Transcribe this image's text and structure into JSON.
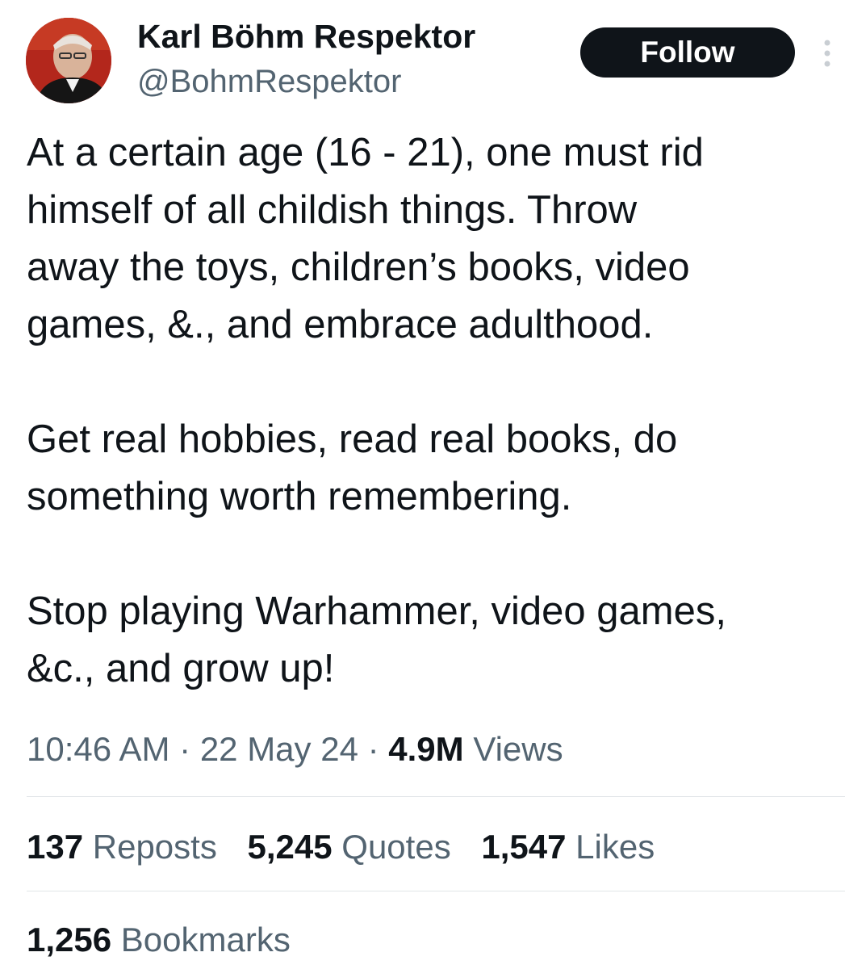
{
  "author": {
    "display_name": "Karl Böhm Respektor",
    "handle": "@BohmRespektor",
    "avatar_icon": "avatar-photo"
  },
  "follow_button": {
    "label": "Follow"
  },
  "more_icon": "more-options-vertical-icon",
  "tweet": {
    "paragraphs": [
      "At a certain age (16 - 21), one must rid\nhimself of all childish things. Throw\naway the toys, children’s books, video\ngames, &., and embrace adulthood.",
      "Get real hobbies, read real books, do\nsomething worth remembering.",
      "Stop playing Warhammer, video games,\n&c., and grow up!"
    ]
  },
  "meta": {
    "time": "10:46 AM",
    "separator": "·",
    "date": "22 May 24",
    "views_count": "4.9M",
    "views_label": "Views"
  },
  "stats": {
    "reposts": {
      "count": "137",
      "label": "Reposts"
    },
    "quotes": {
      "count": "5,245",
      "label": "Quotes"
    },
    "likes": {
      "count": "1,547",
      "label": "Likes"
    },
    "bookmarks": {
      "count": "1,256",
      "label": "Bookmarks"
    }
  },
  "colors": {
    "text_primary": "#0f1419",
    "text_secondary": "#536471",
    "divider": "#e1e5e8",
    "follow_bg": "#0f1419",
    "avatar_bg": "#b3271c"
  }
}
